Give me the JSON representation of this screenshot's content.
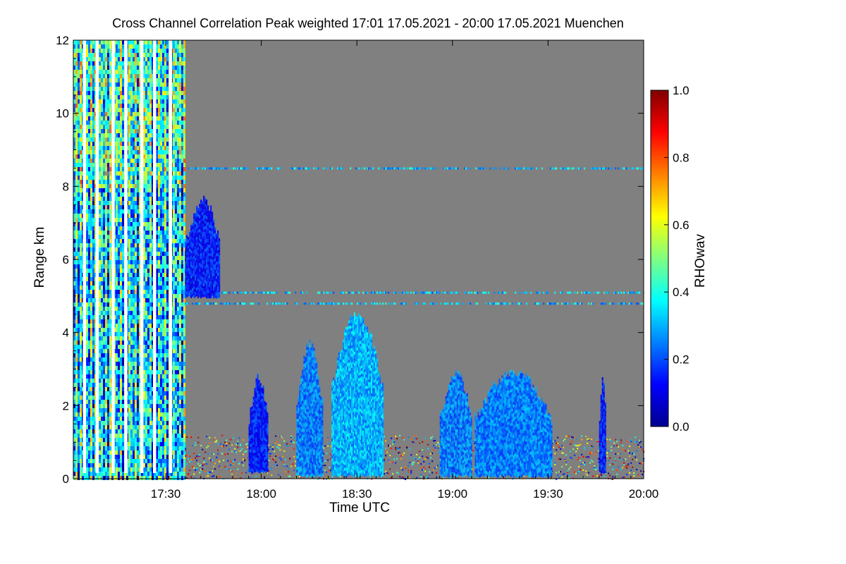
{
  "chart_data": {
    "type": "heatmap",
    "title": "Cross Channel Correlation Peak weighted   17:01 17.05.2021 - 20:00 17.05.2021 Muenchen",
    "xlabel": "Time UTC",
    "ylabel": "Range km",
    "x_range_minutes": [
      1021,
      1200
    ],
    "x_ticks": [
      {
        "label": "17:30",
        "minutes": 1050
      },
      {
        "label": "18:00",
        "minutes": 1080
      },
      {
        "label": "18:30",
        "minutes": 1110
      },
      {
        "label": "19:00",
        "minutes": 1140
      },
      {
        "label": "19:30",
        "minutes": 1170
      },
      {
        "label": "20:00",
        "minutes": 1200
      }
    ],
    "y_range_km": [
      0,
      12
    ],
    "y_ticks": [
      0,
      2,
      4,
      6,
      8,
      10,
      12
    ],
    "colorbar": {
      "label": "RHOwav",
      "range": [
        0,
        1
      ],
      "ticks": [
        "0.0",
        "0.2",
        "0.4",
        "0.6",
        "0.8",
        "1.0"
      ],
      "colormap": [
        "#00008f",
        "#0000ff",
        "#0080ff",
        "#00ffff",
        "#80ff80",
        "#ffff00",
        "#ff8000",
        "#ff0000",
        "#800000"
      ]
    },
    "background_color": "#808080",
    "no_data_color": "#ffffff",
    "data_gaps": [
      {
        "start": "17:04",
        "end": "17:05"
      },
      {
        "start": "17:08",
        "end": "17:09"
      },
      {
        "start": "17:13",
        "end": "17:14"
      },
      {
        "start": "17:17",
        "end": "17:18"
      },
      {
        "start": "17:22",
        "end": "17:23"
      },
      {
        "start": "17:26",
        "end": "17:27"
      },
      {
        "start": "17:31",
        "end": "17:32"
      }
    ],
    "cloud_features": [
      {
        "time_start": "17:36",
        "time_end": "17:47",
        "base_km": 5.0,
        "top_km": 7.8,
        "rho": 0.15
      },
      {
        "time_start": "17:56",
        "time_end": "18:02",
        "base_km": 0.2,
        "top_km": 2.9,
        "rho": 0.15
      },
      {
        "time_start": "18:11",
        "time_end": "18:19",
        "base_km": 0.1,
        "top_km": 3.8,
        "rho": 0.25
      },
      {
        "time_start": "18:22",
        "time_end": "18:38",
        "base_km": 0.1,
        "top_km": 4.7,
        "rho": 0.3
      },
      {
        "time_start": "18:56",
        "time_end": "19:06",
        "base_km": 0.1,
        "top_km": 3.1,
        "rho": 0.25
      },
      {
        "time_start": "19:07",
        "time_end": "19:31",
        "base_km": 0.1,
        "top_km": 3.1,
        "rho": 0.25
      },
      {
        "time_start": "19:46",
        "time_end": "19:48",
        "base_km": 0.2,
        "top_km": 2.9,
        "rho": 0.15
      }
    ],
    "noise_layers_km": [
      4.8,
      5.1,
      8.5
    ]
  }
}
